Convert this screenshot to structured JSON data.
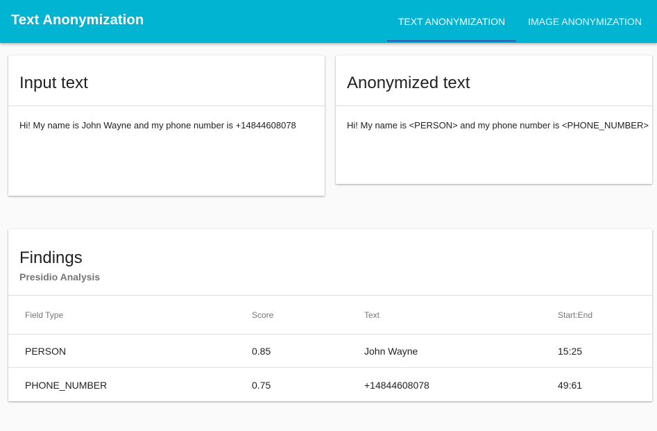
{
  "appbar": {
    "title": "Text Anonymization",
    "tabs": [
      {
        "label": "TEXT ANONYMIZATION"
      },
      {
        "label": "IMAGE ANONYMIZATION"
      }
    ]
  },
  "input_card": {
    "title": "Input text",
    "text": "Hi! My name is John Wayne and my phone number is +14844608078"
  },
  "output_card": {
    "title": "Anonymized text",
    "text": "Hi! My name is <PERSON> and my phone number is <PHONE_NUMBER>"
  },
  "findings": {
    "title": "Findings",
    "subtitle": "Presidio Analysis",
    "columns": [
      "Field Type",
      "Score",
      "Text",
      "Start:End"
    ],
    "rows": [
      [
        "PERSON",
        "0.85",
        "John Wayne",
        "15:25"
      ],
      [
        "PHONE_NUMBER",
        "0.75",
        "+14844608078",
        "49:61"
      ]
    ]
  },
  "colors": {
    "appbar": "#00b4d2",
    "tab_indicator": "#3f51b5"
  }
}
